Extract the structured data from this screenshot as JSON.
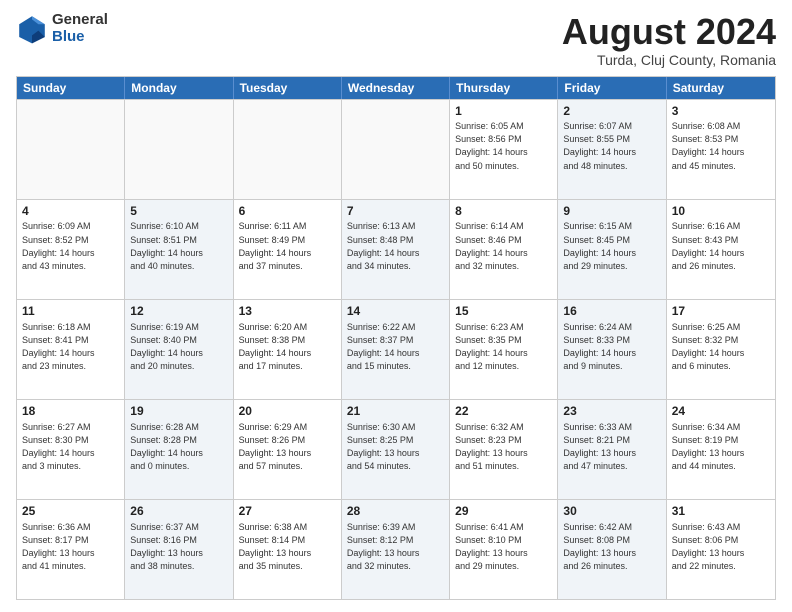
{
  "logo": {
    "general": "General",
    "blue": "Blue"
  },
  "title": "August 2024",
  "subtitle": "Turda, Cluj County, Romania",
  "days": [
    "Sunday",
    "Monday",
    "Tuesday",
    "Wednesday",
    "Thursday",
    "Friday",
    "Saturday"
  ],
  "rows": [
    [
      {
        "day": "",
        "info": "",
        "empty": true,
        "shaded": false
      },
      {
        "day": "",
        "info": "",
        "empty": true,
        "shaded": false
      },
      {
        "day": "",
        "info": "",
        "empty": true,
        "shaded": false
      },
      {
        "day": "",
        "info": "",
        "empty": true,
        "shaded": false
      },
      {
        "day": "1",
        "info": "Sunrise: 6:05 AM\nSunset: 8:56 PM\nDaylight: 14 hours\nand 50 minutes.",
        "empty": false,
        "shaded": false
      },
      {
        "day": "2",
        "info": "Sunrise: 6:07 AM\nSunset: 8:55 PM\nDaylight: 14 hours\nand 48 minutes.",
        "empty": false,
        "shaded": true
      },
      {
        "day": "3",
        "info": "Sunrise: 6:08 AM\nSunset: 8:53 PM\nDaylight: 14 hours\nand 45 minutes.",
        "empty": false,
        "shaded": false
      }
    ],
    [
      {
        "day": "4",
        "info": "Sunrise: 6:09 AM\nSunset: 8:52 PM\nDaylight: 14 hours\nand 43 minutes.",
        "empty": false,
        "shaded": false
      },
      {
        "day": "5",
        "info": "Sunrise: 6:10 AM\nSunset: 8:51 PM\nDaylight: 14 hours\nand 40 minutes.",
        "empty": false,
        "shaded": true
      },
      {
        "day": "6",
        "info": "Sunrise: 6:11 AM\nSunset: 8:49 PM\nDaylight: 14 hours\nand 37 minutes.",
        "empty": false,
        "shaded": false
      },
      {
        "day": "7",
        "info": "Sunrise: 6:13 AM\nSunset: 8:48 PM\nDaylight: 14 hours\nand 34 minutes.",
        "empty": false,
        "shaded": true
      },
      {
        "day": "8",
        "info": "Sunrise: 6:14 AM\nSunset: 8:46 PM\nDaylight: 14 hours\nand 32 minutes.",
        "empty": false,
        "shaded": false
      },
      {
        "day": "9",
        "info": "Sunrise: 6:15 AM\nSunset: 8:45 PM\nDaylight: 14 hours\nand 29 minutes.",
        "empty": false,
        "shaded": true
      },
      {
        "day": "10",
        "info": "Sunrise: 6:16 AM\nSunset: 8:43 PM\nDaylight: 14 hours\nand 26 minutes.",
        "empty": false,
        "shaded": false
      }
    ],
    [
      {
        "day": "11",
        "info": "Sunrise: 6:18 AM\nSunset: 8:41 PM\nDaylight: 14 hours\nand 23 minutes.",
        "empty": false,
        "shaded": false
      },
      {
        "day": "12",
        "info": "Sunrise: 6:19 AM\nSunset: 8:40 PM\nDaylight: 14 hours\nand 20 minutes.",
        "empty": false,
        "shaded": true
      },
      {
        "day": "13",
        "info": "Sunrise: 6:20 AM\nSunset: 8:38 PM\nDaylight: 14 hours\nand 17 minutes.",
        "empty": false,
        "shaded": false
      },
      {
        "day": "14",
        "info": "Sunrise: 6:22 AM\nSunset: 8:37 PM\nDaylight: 14 hours\nand 15 minutes.",
        "empty": false,
        "shaded": true
      },
      {
        "day": "15",
        "info": "Sunrise: 6:23 AM\nSunset: 8:35 PM\nDaylight: 14 hours\nand 12 minutes.",
        "empty": false,
        "shaded": false
      },
      {
        "day": "16",
        "info": "Sunrise: 6:24 AM\nSunset: 8:33 PM\nDaylight: 14 hours\nand 9 minutes.",
        "empty": false,
        "shaded": true
      },
      {
        "day": "17",
        "info": "Sunrise: 6:25 AM\nSunset: 8:32 PM\nDaylight: 14 hours\nand 6 minutes.",
        "empty": false,
        "shaded": false
      }
    ],
    [
      {
        "day": "18",
        "info": "Sunrise: 6:27 AM\nSunset: 8:30 PM\nDaylight: 14 hours\nand 3 minutes.",
        "empty": false,
        "shaded": false
      },
      {
        "day": "19",
        "info": "Sunrise: 6:28 AM\nSunset: 8:28 PM\nDaylight: 14 hours\nand 0 minutes.",
        "empty": false,
        "shaded": true
      },
      {
        "day": "20",
        "info": "Sunrise: 6:29 AM\nSunset: 8:26 PM\nDaylight: 13 hours\nand 57 minutes.",
        "empty": false,
        "shaded": false
      },
      {
        "day": "21",
        "info": "Sunrise: 6:30 AM\nSunset: 8:25 PM\nDaylight: 13 hours\nand 54 minutes.",
        "empty": false,
        "shaded": true
      },
      {
        "day": "22",
        "info": "Sunrise: 6:32 AM\nSunset: 8:23 PM\nDaylight: 13 hours\nand 51 minutes.",
        "empty": false,
        "shaded": false
      },
      {
        "day": "23",
        "info": "Sunrise: 6:33 AM\nSunset: 8:21 PM\nDaylight: 13 hours\nand 47 minutes.",
        "empty": false,
        "shaded": true
      },
      {
        "day": "24",
        "info": "Sunrise: 6:34 AM\nSunset: 8:19 PM\nDaylight: 13 hours\nand 44 minutes.",
        "empty": false,
        "shaded": false
      }
    ],
    [
      {
        "day": "25",
        "info": "Sunrise: 6:36 AM\nSunset: 8:17 PM\nDaylight: 13 hours\nand 41 minutes.",
        "empty": false,
        "shaded": false
      },
      {
        "day": "26",
        "info": "Sunrise: 6:37 AM\nSunset: 8:16 PM\nDaylight: 13 hours\nand 38 minutes.",
        "empty": false,
        "shaded": true
      },
      {
        "day": "27",
        "info": "Sunrise: 6:38 AM\nSunset: 8:14 PM\nDaylight: 13 hours\nand 35 minutes.",
        "empty": false,
        "shaded": false
      },
      {
        "day": "28",
        "info": "Sunrise: 6:39 AM\nSunset: 8:12 PM\nDaylight: 13 hours\nand 32 minutes.",
        "empty": false,
        "shaded": true
      },
      {
        "day": "29",
        "info": "Sunrise: 6:41 AM\nSunset: 8:10 PM\nDaylight: 13 hours\nand 29 minutes.",
        "empty": false,
        "shaded": false
      },
      {
        "day": "30",
        "info": "Sunrise: 6:42 AM\nSunset: 8:08 PM\nDaylight: 13 hours\nand 26 minutes.",
        "empty": false,
        "shaded": true
      },
      {
        "day": "31",
        "info": "Sunrise: 6:43 AM\nSunset: 8:06 PM\nDaylight: 13 hours\nand 22 minutes.",
        "empty": false,
        "shaded": false
      }
    ]
  ]
}
